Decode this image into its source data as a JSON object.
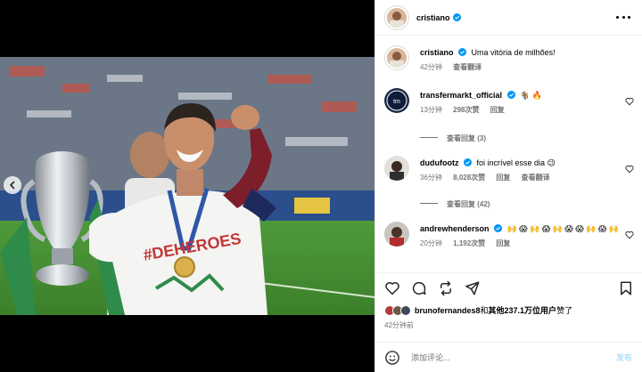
{
  "post": {
    "author": "cristiano",
    "caption": "Uma vitória de milhões!",
    "caption_time": "42分钟",
    "caption_translate": "查看翻译"
  },
  "comments": [
    {
      "user": "transfermarkt_official",
      "text": "🐐 🔥",
      "time": "13分钟",
      "likes": "298次赞",
      "reply": "回复",
      "view_replies": "查看回复 (3)"
    },
    {
      "user": "dudufootz",
      "text": "foi incrível esse dia 😉",
      "time": "36分钟",
      "likes": "8,028次赞",
      "reply": "回复",
      "translate": "查看翻译",
      "view_replies": "查看回复 (42)"
    },
    {
      "user": "andrewhenderson",
      "text": "🙌 😱 🙌 😱 🙌 😱 😱 🙌 😱 🙌",
      "time": "20分钟",
      "likes": "1,192次赞",
      "reply": "回复"
    }
  ],
  "liked_by": {
    "user": "brunofernandes8",
    "conj": "和",
    "others": "其他237.1万位用户",
    "suffix": "赞了"
  },
  "posted_ago": "42分钟前",
  "add_comment": {
    "placeholder": "添加评论...",
    "post_label": "发布"
  },
  "colors": {
    "verified": "#0095f6",
    "post_button_disabled": "#b2dffc",
    "muted_text": "#737373"
  }
}
